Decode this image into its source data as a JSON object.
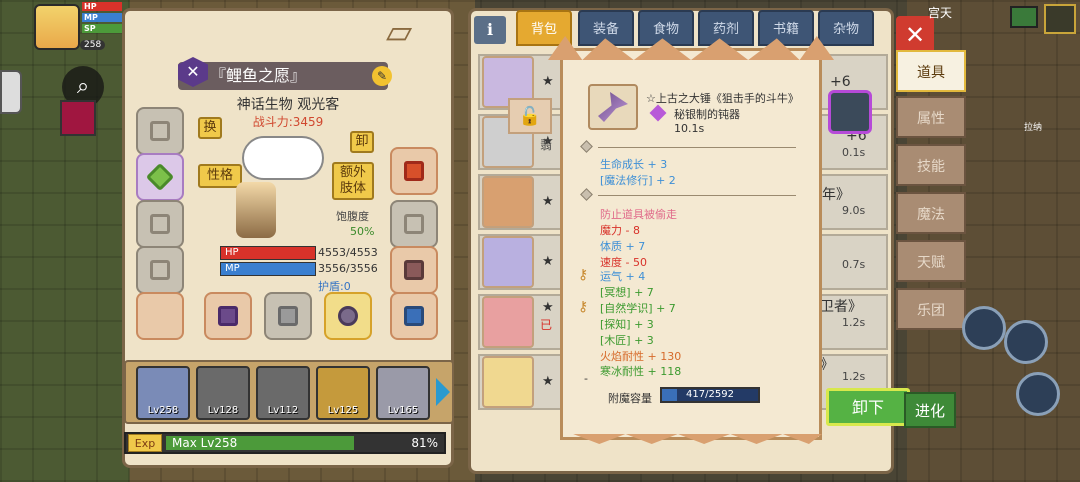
{
  "hud": {
    "level": "258",
    "stat_labels": [
      "HP",
      "MP",
      "SP"
    ],
    "top_right_text": "宫天",
    "storage_label": "拉纳"
  },
  "character": {
    "name": "『鲤鱼之愿』",
    "class_icon": "x-class-icon",
    "subtitle": "神话生物 观光客",
    "power": "战斗力:3459",
    "swap_label": "换",
    "unequip_label": "卸",
    "personality_label": "性格",
    "extra_limb_label": "额外\n肢体",
    "satiety_label": "饱腹度",
    "satiety_value": "50%",
    "hp_label": "HP",
    "hp_value": "4553/4553",
    "hp_fraction": 1.0,
    "mp_label": "MP",
    "mp_value": "3556/3556",
    "mp_fraction": 1.0,
    "shield": "护盾:0"
  },
  "party": [
    {
      "level": "Lv258"
    },
    {
      "level": "Lv128"
    },
    {
      "level": "Lv112"
    },
    {
      "level": "Lv125"
    },
    {
      "level": "Lv165"
    }
  ],
  "experience": {
    "tag": "Exp",
    "label": "Max Lv258",
    "percent_text": "81%",
    "fraction": 0.81
  },
  "inventory": {
    "info_label": "i",
    "tabs": [
      "背包",
      "装备",
      "食物",
      "药剂",
      "书籍",
      "杂物"
    ],
    "active_tab": 0,
    "side_tabs": [
      "道具",
      "属性",
      "技能",
      "魔法",
      "天赋",
      "乐团"
    ],
    "active_side_tab": 0,
    "rows": [
      {
        "star": "★",
        "extra": "+6",
        "time": ""
      },
      {
        "star": "★",
        "extra": "+6",
        "time": "0.1s"
      },
      {
        "star": "★",
        "extra": "年》",
        "time": "9.0s"
      },
      {
        "star": "★",
        "extra": "",
        "time": "0.7s"
      },
      {
        "star": "★",
        "extra": "卫者》",
        "time": "1.2s"
      },
      {
        "star": "★",
        "extra": "》",
        "time": "1.2s"
      }
    ],
    "partial_row_text": [
      "翡",
      "已"
    ],
    "unequip_button": "卸下",
    "evolve_button": "进化",
    "close_label": "✕"
  },
  "tooltip": {
    "title": "☆上古之大锤《狙击手的斗牛》",
    "material": "秘银制的钝器",
    "speed": "10.1s",
    "section1": [
      {
        "text": "生命成长 + 3",
        "color": "blue"
      },
      {
        "text": "[魔法修行] + 2",
        "color": "blue"
      }
    ],
    "section2": [
      {
        "text": "防止道具被偷走",
        "color": "pink",
        "key": false
      },
      {
        "text": "魔力 - 8",
        "color": "red",
        "key": false
      },
      {
        "text": "体质 + 7",
        "color": "blue",
        "key": false
      },
      {
        "text": "速度 - 50",
        "color": "red",
        "key": false
      },
      {
        "text": "运气 + 4",
        "color": "blue",
        "key": true
      },
      {
        "text": "[冥想] + 7",
        "color": "green",
        "key": false
      },
      {
        "text": "[自然学识] + 7",
        "color": "green",
        "key": true
      },
      {
        "text": "[探知] + 3",
        "color": "green",
        "key": false
      },
      {
        "text": "[木匠] + 3",
        "color": "green",
        "key": false
      },
      {
        "text": "火焰耐性 + 130",
        "color": "orange",
        "key": false
      },
      {
        "text": "寒冰耐性 + 118",
        "color": "green",
        "key": false
      }
    ],
    "dash": "-",
    "enchant_label": "附魔容量",
    "enchant_value": "417/2592",
    "enchant_fraction": 0.161
  },
  "colors": {
    "panel_bg": "#efe3c8",
    "tab_active": "#e5a930",
    "tab_inactive": "#3e5575",
    "hp_bar": "#d8322a",
    "mp_bar": "#3a7fd0",
    "unequip_green": "#55b244"
  }
}
